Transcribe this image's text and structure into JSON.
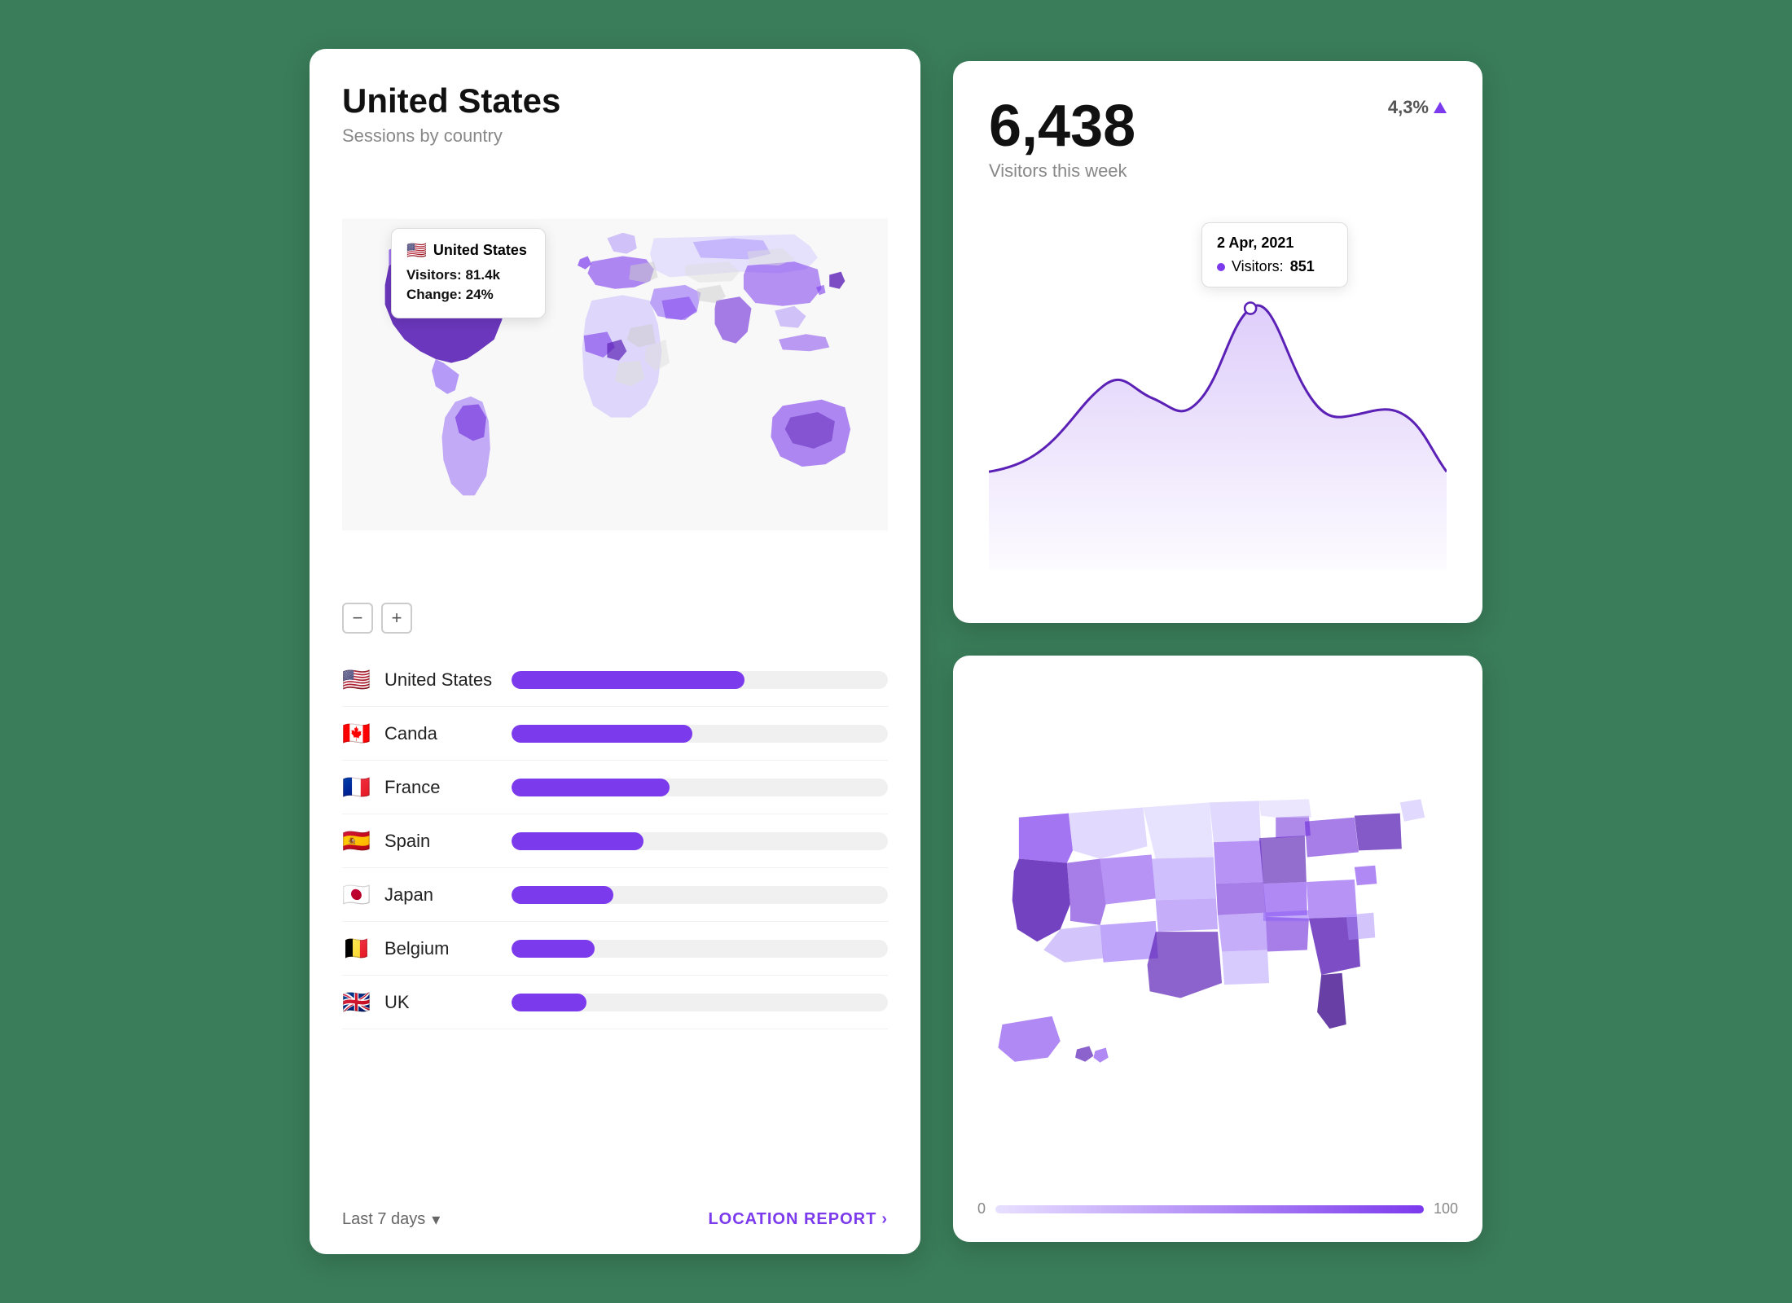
{
  "left_card": {
    "title": "United States",
    "subtitle": "Sessions by country",
    "tooltip": {
      "flag": "🇺🇸",
      "country": "United States",
      "visitors_label": "Visitors:",
      "visitors_value": "81.4k",
      "change_label": "Change:",
      "change_value": "24%"
    },
    "zoom_minus": "−",
    "zoom_plus": "+",
    "countries": [
      {
        "flag": "🇺🇸",
        "name": "United States",
        "bar_pct": 62
      },
      {
        "flag": "🇨🇦",
        "name": "Canda",
        "bar_pct": 48
      },
      {
        "flag": "🇫🇷",
        "name": "France",
        "bar_pct": 42
      },
      {
        "flag": "🇪🇸",
        "name": "Spain",
        "bar_pct": 35
      },
      {
        "flag": "🇯🇵",
        "name": "Japan",
        "bar_pct": 27
      },
      {
        "flag": "🇧🇪",
        "name": "Belgium",
        "bar_pct": 22
      },
      {
        "flag": "🇬🇧",
        "name": "UK",
        "bar_pct": 20
      }
    ],
    "footer": {
      "date_range": "Last 7 days",
      "chevron": "▾",
      "location_report": "LOCATION REPORT",
      "chevron_right": "›"
    }
  },
  "visitors_card": {
    "count": "6,438",
    "label": "Visitors this week",
    "change": "4,3%",
    "arrow": "up",
    "tooltip": {
      "date": "2 Apr, 2021",
      "visitors_label": "Visitors:",
      "visitors_value": "851"
    }
  },
  "us_card": {
    "legend_min": "0",
    "legend_max": "100"
  }
}
